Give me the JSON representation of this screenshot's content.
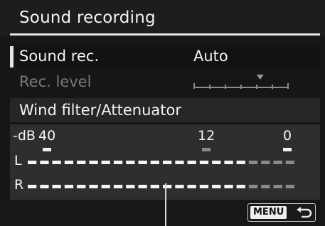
{
  "header": {
    "title": "Sound recording"
  },
  "menu": {
    "sound_rec": {
      "label": "Sound rec.",
      "value": "Auto"
    },
    "rec_level": {
      "label": "Rec. level",
      "level_fraction": 0.7
    },
    "wind_filter": {
      "label": "Wind filter/Attenuator"
    }
  },
  "meter": {
    "db_label": "-dB",
    "scale": [
      "40",
      "12",
      "0"
    ],
    "channels": [
      "L",
      "R"
    ],
    "segments_per_channel": 22
  },
  "footer": {
    "menu_button": "MENU",
    "back_icon": "return-arrow-icon"
  },
  "colors": {
    "background": "#161616",
    "selected_row": "#121212",
    "panel": "#2e2e2e",
    "text": "#f4f4f4",
    "dim_text": "#7a7a7a",
    "meter_segment": "#f4f4f4",
    "meter_segment_dim": "#8a8a8a"
  }
}
